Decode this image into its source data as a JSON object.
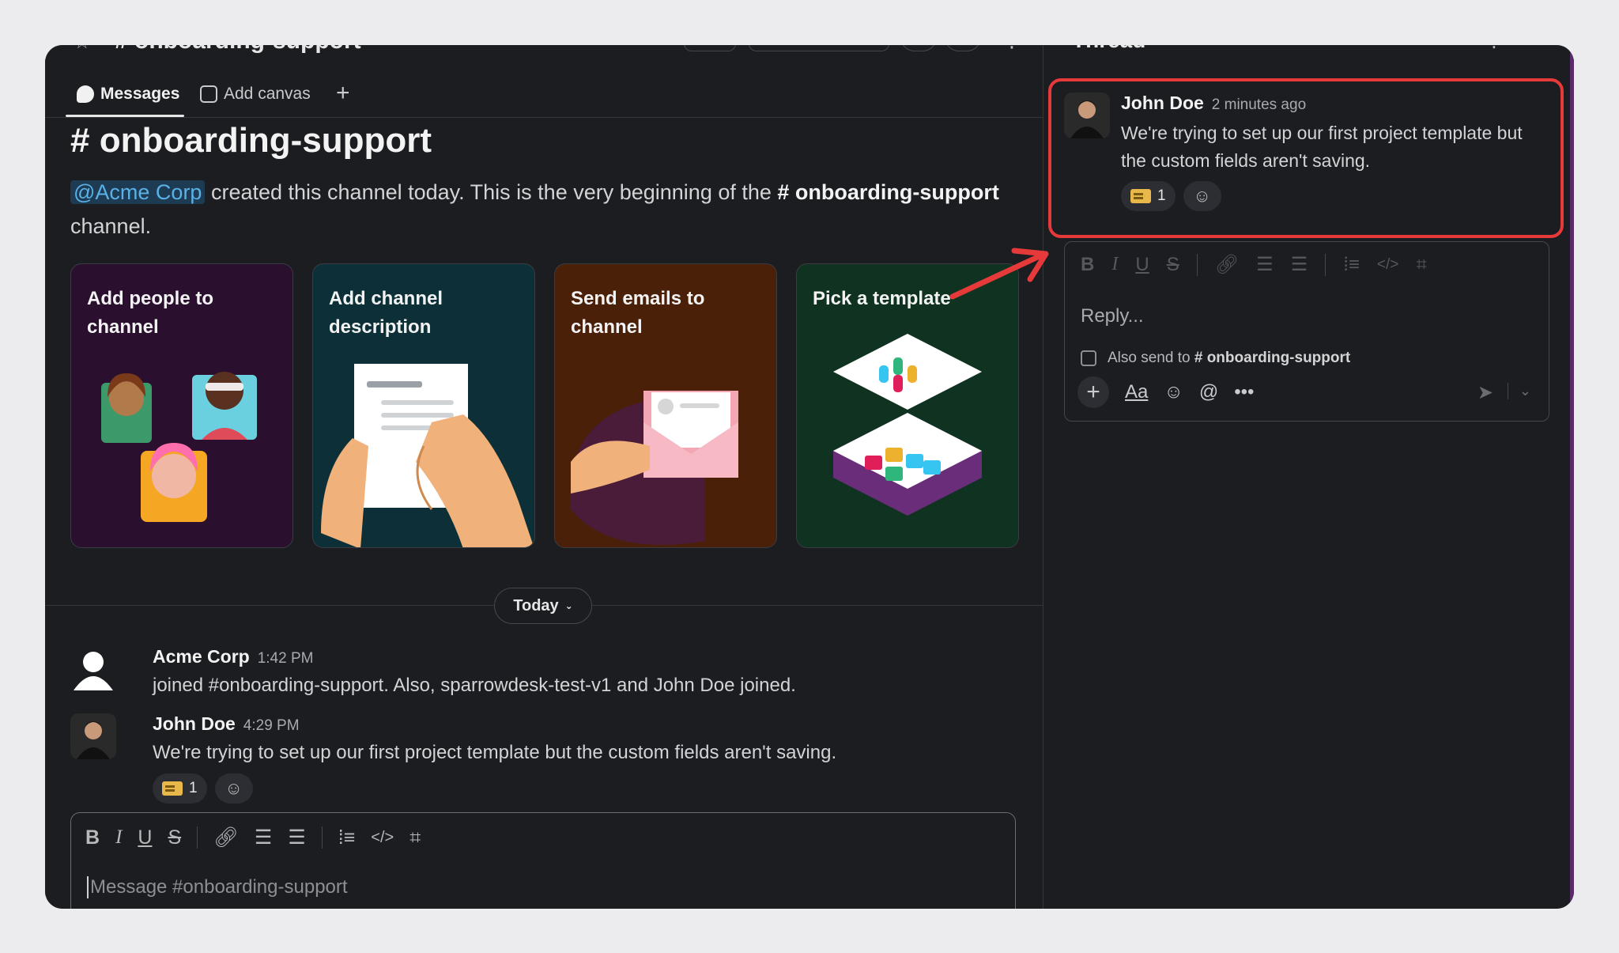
{
  "channel": {
    "name": "onboarding-support",
    "header_title": "# onboarding-support"
  },
  "tabs": [
    {
      "label": "Messages"
    },
    {
      "label": "Add canvas"
    }
  ],
  "intro": {
    "title_hash": "#",
    "title": "onboarding-support",
    "mention": "@Acme Corp",
    "text_before": " created this channel today. This is the very beginning of the ",
    "channel_bold": "# onboarding-support",
    "text_after": " channel."
  },
  "cards": [
    {
      "title": "Add people to channel",
      "bg": "#2a0f2e"
    },
    {
      "title": "Add channel description",
      "bg": "#0d3038"
    },
    {
      "title": "Send emails to channel",
      "bg": "#4a2008"
    },
    {
      "title": "Pick a template",
      "bg": "#0f3320"
    }
  ],
  "divider": {
    "label": "Today"
  },
  "messages": [
    {
      "author": "Acme Corp",
      "time": "1:42 PM",
      "text": "joined #onboarding-support. Also, sparrowdesk-test-v1 and John Doe joined."
    },
    {
      "author": "John Doe",
      "time": "4:29 PM",
      "text": "We're trying to set up our first project template but the custom fields aren't saving.",
      "reaction_count": "1"
    }
  ],
  "composer": {
    "placeholder": "Message #onboarding-support"
  },
  "thread": {
    "title": "Thread",
    "message": {
      "author": "John Doe",
      "time": "2 minutes ago",
      "text": "We're trying to set up our first project template but the custom fields aren't saving.",
      "reaction_count": "1"
    },
    "reply_placeholder": "Reply...",
    "also_send_prefix": "Also send to",
    "also_send_channel": "# onboarding-support"
  },
  "colors": {
    "highlight": "#e5393a",
    "mention": "#5bb0e8"
  }
}
